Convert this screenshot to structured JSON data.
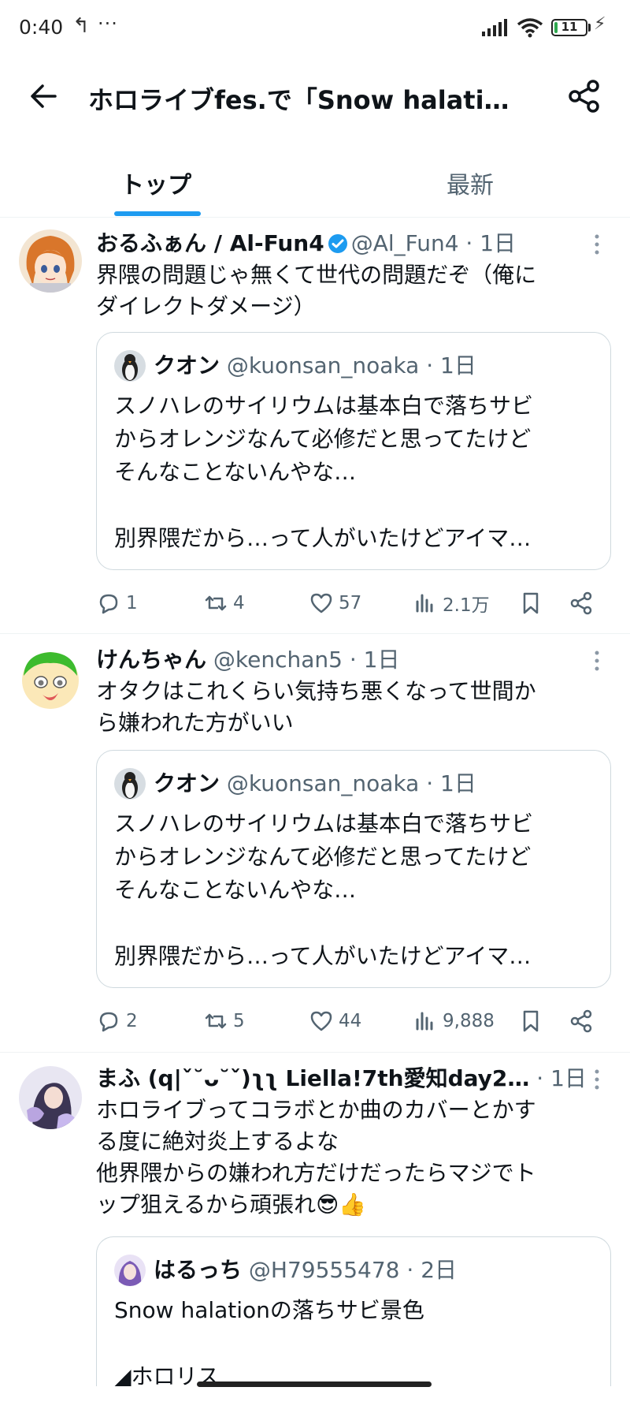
{
  "status_bar": {
    "time": "0:40",
    "back_glyph": "↰",
    "more_glyph": "···",
    "battery": "11",
    "battery_level": 0.11,
    "bolt_glyph": "⚡"
  },
  "header": {
    "title": "ホロライブfes.で「Snow halati…",
    "back_icon": "arrow-left-icon",
    "share_icon": "share-icon"
  },
  "tabs": [
    {
      "label": "トップ",
      "active": true
    },
    {
      "label": "最新",
      "active": false
    }
  ],
  "posts": [
    {
      "name": "おるふぁん / Al-Fun4",
      "verified": true,
      "handle": "@Al_Fun4 · 1日",
      "text": "界隈の問題じゃ無くて世代の問題だぞ（俺に\nダイレクトダメージ）",
      "quote": {
        "name": "クオン",
        "handle": "@kuonsan_noaka · 1日",
        "text": "スノハレのサイリウムは基本白で落ちサビ\nからオレンジなんて必修だと思ってたけど\nそんなことないんやな…\n\n別界隈だから…って人がいたけどアイマ…"
      },
      "replies": "1",
      "reposts": "4",
      "likes": "57",
      "views": "2.1万"
    },
    {
      "name": "けんちゃん",
      "verified": false,
      "handle": "@kenchan5 · 1日",
      "text": "オタクはこれくらい気持ち悪くなって世間か\nら嫌われた方がいい",
      "quote": {
        "name": "クオン",
        "handle": "@kuonsan_noaka · 1日",
        "text": "スノハレのサイリウムは基本白で落ちサビ\nからオレンジなんて必修だと思ってたけど\nそんなことないんやな…\n\n別界隈だから…って人がいたけどアイマ…"
      },
      "replies": "2",
      "reposts": "5",
      "likes": "44",
      "views": "9,888"
    },
    {
      "name": "まふ (q|ˇ˘ᴗ˘ˇ)ʅʅ Liella!7th愛知day2…",
      "verified": false,
      "handle": "· 1日",
      "text": "ホロライブってコラボとか曲のカバーとかす\nる度に絶対炎上するよな\n他界隈からの嫌われ方だけだったらマジでト\nップ狙えるから頑張れ😎👍",
      "quote": {
        "name": "はるっち",
        "handle": "@H79555478 · 2日",
        "text": "Snow halationの落ちサビ景色\n\n◢ホロリス"
      }
    }
  ],
  "colors": {
    "accent": "#1d9bf0",
    "muted_text": "#536471",
    "border": "#cfd9de",
    "verified": "#1d9bf0"
  }
}
